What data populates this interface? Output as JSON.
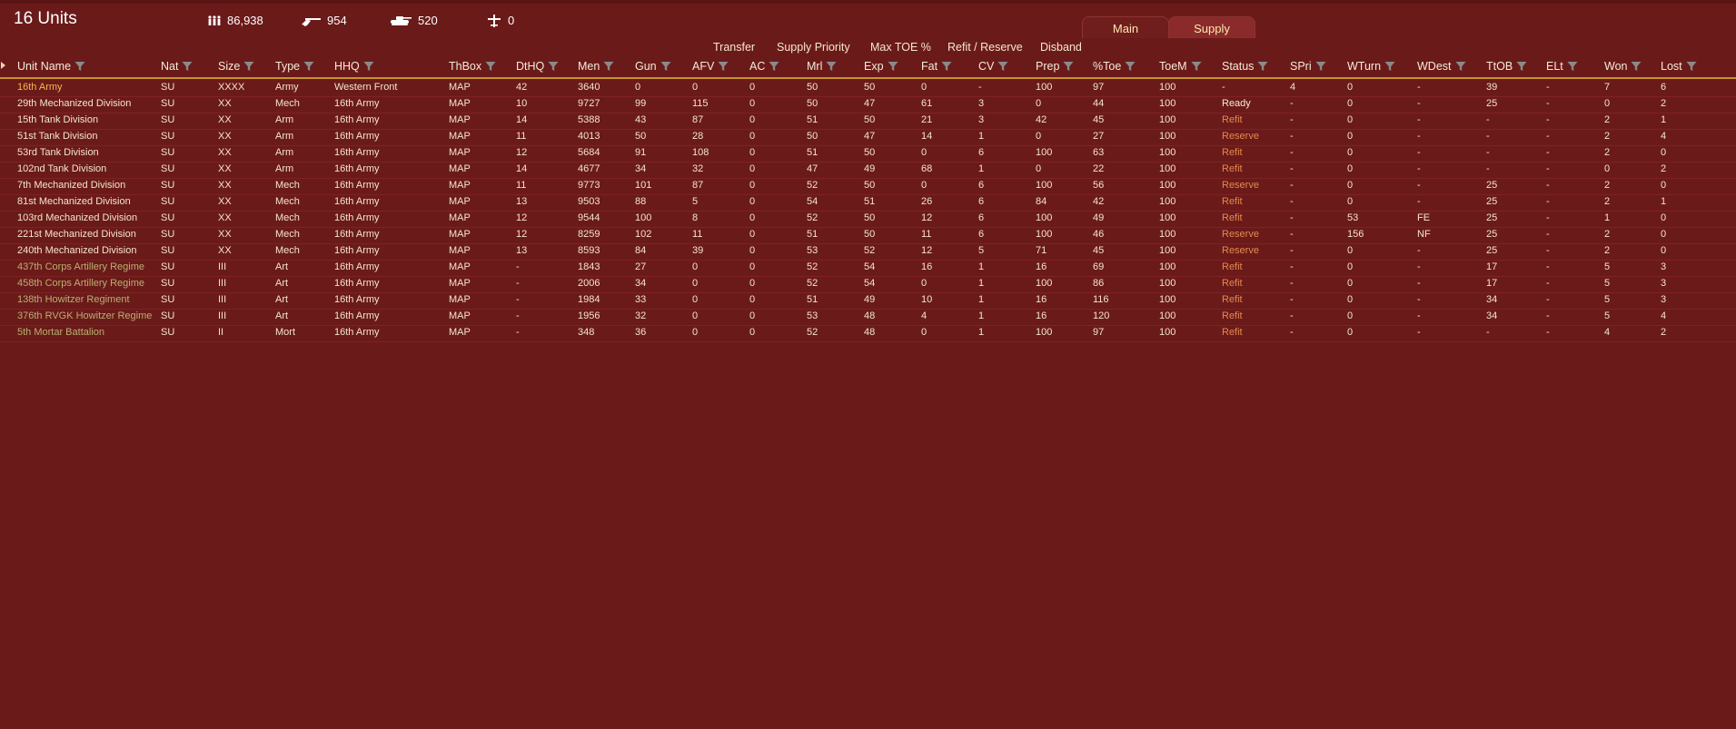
{
  "header": {
    "title": "16 Units",
    "stats": {
      "men": "86,938",
      "guns": "954",
      "afv": "520",
      "aircraft": "0"
    }
  },
  "tabs": [
    "Main",
    "Supply"
  ],
  "actions": [
    "Transfer",
    "Supply Priority",
    "Max TOE %",
    "Refit / Reserve",
    "Disband"
  ],
  "columns": [
    "Unit Name",
    "Nat",
    "Size",
    "Type",
    "HHQ",
    "ThBox",
    "DtHQ",
    "Men",
    "Gun",
    "AFV",
    "AC",
    "Mrl",
    "Exp",
    "Fat",
    "CV",
    "Prep",
    "%Toe",
    "ToeM",
    "Status",
    "SPri",
    "WTurn",
    "WDest",
    "TtOB",
    "ELt",
    "Won",
    "Lost"
  ],
  "rows": [
    {
      "kind": "army",
      "cells": [
        "16th Army",
        "SU",
        "XXXX",
        "Army",
        "Western Front",
        "MAP",
        "42",
        "3640",
        "0",
        "0",
        "0",
        "50",
        "50",
        "0",
        "-",
        "100",
        "97",
        "100",
        "-",
        "4",
        "0",
        "-",
        "39",
        "-",
        "7",
        "6"
      ]
    },
    {
      "kind": "mech",
      "cells": [
        "29th Mechanized Division",
        "SU",
        "XX",
        "Mech",
        "16th Army",
        "MAP",
        "10",
        "9727",
        "99",
        "115",
        "0",
        "50",
        "47",
        "61",
        "3",
        "0",
        "44",
        "100",
        "Ready",
        "-",
        "0",
        "-",
        "25",
        "-",
        "0",
        "2"
      ]
    },
    {
      "kind": "mech",
      "cells": [
        "15th Tank Division",
        "SU",
        "XX",
        "Arm",
        "16th Army",
        "MAP",
        "14",
        "5388",
        "43",
        "87",
        "0",
        "51",
        "50",
        "21",
        "3",
        "42",
        "45",
        "100",
        "Refit",
        "-",
        "0",
        "-",
        "-",
        "-",
        "2",
        "1"
      ]
    },
    {
      "kind": "mech",
      "cells": [
        "51st Tank Division",
        "SU",
        "XX",
        "Arm",
        "16th Army",
        "MAP",
        "11",
        "4013",
        "50",
        "28",
        "0",
        "50",
        "47",
        "14",
        "1",
        "0",
        "27",
        "100",
        "Reserve",
        "-",
        "0",
        "-",
        "-",
        "-",
        "2",
        "4"
      ]
    },
    {
      "kind": "mech",
      "cells": [
        "53rd Tank Division",
        "SU",
        "XX",
        "Arm",
        "16th Army",
        "MAP",
        "12",
        "5684",
        "91",
        "108",
        "0",
        "51",
        "50",
        "0",
        "6",
        "100",
        "63",
        "100",
        "Refit",
        "-",
        "0",
        "-",
        "-",
        "-",
        "2",
        "0"
      ]
    },
    {
      "kind": "mech",
      "cells": [
        "102nd Tank Division",
        "SU",
        "XX",
        "Arm",
        "16th Army",
        "MAP",
        "14",
        "4677",
        "34",
        "32",
        "0",
        "47",
        "49",
        "68",
        "1",
        "0",
        "22",
        "100",
        "Refit",
        "-",
        "0",
        "-",
        "-",
        "-",
        "0",
        "2"
      ]
    },
    {
      "kind": "mech",
      "cells": [
        "7th Mechanized Division",
        "SU",
        "XX",
        "Mech",
        "16th Army",
        "MAP",
        "11",
        "9773",
        "101",
        "87",
        "0",
        "52",
        "50",
        "0",
        "6",
        "100",
        "56",
        "100",
        "Reserve",
        "-",
        "0",
        "-",
        "25",
        "-",
        "2",
        "0"
      ]
    },
    {
      "kind": "mech",
      "cells": [
        "81st Mechanized Division",
        "SU",
        "XX",
        "Mech",
        "16th Army",
        "MAP",
        "13",
        "9503",
        "88",
        "5",
        "0",
        "54",
        "51",
        "26",
        "6",
        "84",
        "42",
        "100",
        "Refit",
        "-",
        "0",
        "-",
        "25",
        "-",
        "2",
        "1"
      ]
    },
    {
      "kind": "mech",
      "cells": [
        "103rd Mechanized Division",
        "SU",
        "XX",
        "Mech",
        "16th Army",
        "MAP",
        "12",
        "9544",
        "100",
        "8",
        "0",
        "52",
        "50",
        "12",
        "6",
        "100",
        "49",
        "100",
        "Refit",
        "-",
        "53",
        "FE",
        "25",
        "-",
        "1",
        "0"
      ]
    },
    {
      "kind": "mech",
      "cells": [
        "221st Mechanized Division",
        "SU",
        "XX",
        "Mech",
        "16th Army",
        "MAP",
        "12",
        "8259",
        "102",
        "11",
        "0",
        "51",
        "50",
        "11",
        "6",
        "100",
        "46",
        "100",
        "Reserve",
        "-",
        "156",
        "NF",
        "25",
        "-",
        "2",
        "0"
      ]
    },
    {
      "kind": "mech",
      "cells": [
        "240th Mechanized Division",
        "SU",
        "XX",
        "Mech",
        "16th Army",
        "MAP",
        "13",
        "8593",
        "84",
        "39",
        "0",
        "53",
        "52",
        "12",
        "5",
        "71",
        "45",
        "100",
        "Reserve",
        "-",
        "0",
        "-",
        "25",
        "-",
        "2",
        "0"
      ]
    },
    {
      "kind": "art",
      "cells": [
        "437th Corps Artillery Regime",
        "SU",
        "III",
        "Art",
        "16th Army",
        "MAP",
        "-",
        "1843",
        "27",
        "0",
        "0",
        "52",
        "54",
        "16",
        "1",
        "16",
        "69",
        "100",
        "Refit",
        "-",
        "0",
        "-",
        "17",
        "-",
        "5",
        "3"
      ]
    },
    {
      "kind": "art",
      "cells": [
        "458th Corps Artillery Regime",
        "SU",
        "III",
        "Art",
        "16th Army",
        "MAP",
        "-",
        "2006",
        "34",
        "0",
        "0",
        "52",
        "54",
        "0",
        "1",
        "100",
        "86",
        "100",
        "Refit",
        "-",
        "0",
        "-",
        "17",
        "-",
        "5",
        "3"
      ]
    },
    {
      "kind": "art",
      "cells": [
        "138th Howitzer Regiment",
        "SU",
        "III",
        "Art",
        "16th Army",
        "MAP",
        "-",
        "1984",
        "33",
        "0",
        "0",
        "51",
        "49",
        "10",
        "1",
        "16",
        "116",
        "100",
        "Refit",
        "-",
        "0",
        "-",
        "34",
        "-",
        "5",
        "3"
      ]
    },
    {
      "kind": "art",
      "cells": [
        "376th RVGK Howitzer Regime",
        "SU",
        "III",
        "Art",
        "16th Army",
        "MAP",
        "-",
        "1956",
        "32",
        "0",
        "0",
        "53",
        "48",
        "4",
        "1",
        "16",
        "120",
        "100",
        "Refit",
        "-",
        "0",
        "-",
        "34",
        "-",
        "5",
        "4"
      ]
    },
    {
      "kind": "art",
      "cells": [
        "5th Mortar Battalion",
        "SU",
        "II",
        "Mort",
        "16th Army",
        "MAP",
        "-",
        "348",
        "36",
        "0",
        "0",
        "52",
        "48",
        "0",
        "1",
        "100",
        "97",
        "100",
        "Refit",
        "-",
        "0",
        "-",
        "-",
        "-",
        "4",
        "2"
      ]
    }
  ]
}
